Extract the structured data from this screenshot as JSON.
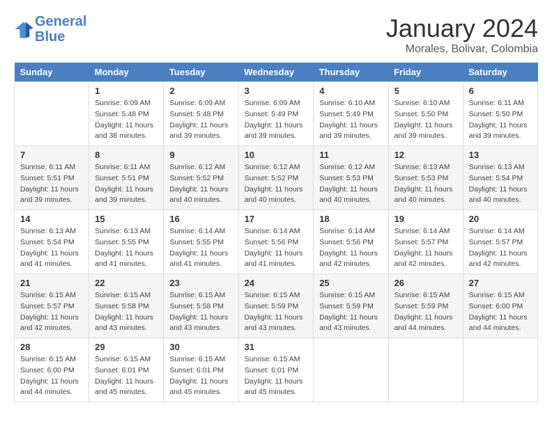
{
  "header": {
    "logo_line1": "General",
    "logo_line2": "Blue",
    "month_year": "January 2024",
    "location": "Morales, Bolivar, Colombia"
  },
  "calendar": {
    "days_of_week": [
      "Sunday",
      "Monday",
      "Tuesday",
      "Wednesday",
      "Thursday",
      "Friday",
      "Saturday"
    ],
    "weeks": [
      [
        {
          "day": "",
          "info": ""
        },
        {
          "day": "1",
          "info": "Sunrise: 6:09 AM\nSunset: 5:48 PM\nDaylight: 11 hours\nand 38 minutes."
        },
        {
          "day": "2",
          "info": "Sunrise: 6:09 AM\nSunset: 5:48 PM\nDaylight: 11 hours\nand 39 minutes."
        },
        {
          "day": "3",
          "info": "Sunrise: 6:09 AM\nSunset: 5:49 PM\nDaylight: 11 hours\nand 39 minutes."
        },
        {
          "day": "4",
          "info": "Sunrise: 6:10 AM\nSunset: 5:49 PM\nDaylight: 11 hours\nand 39 minutes."
        },
        {
          "day": "5",
          "info": "Sunrise: 6:10 AM\nSunset: 5:50 PM\nDaylight: 11 hours\nand 39 minutes."
        },
        {
          "day": "6",
          "info": "Sunrise: 6:11 AM\nSunset: 5:50 PM\nDaylight: 11 hours\nand 39 minutes."
        }
      ],
      [
        {
          "day": "7",
          "info": "Sunrise: 6:11 AM\nSunset: 5:51 PM\nDaylight: 11 hours\nand 39 minutes."
        },
        {
          "day": "8",
          "info": "Sunrise: 6:11 AM\nSunset: 5:51 PM\nDaylight: 11 hours\nand 39 minutes."
        },
        {
          "day": "9",
          "info": "Sunrise: 6:12 AM\nSunset: 5:52 PM\nDaylight: 11 hours\nand 40 minutes."
        },
        {
          "day": "10",
          "info": "Sunrise: 6:12 AM\nSunset: 5:52 PM\nDaylight: 11 hours\nand 40 minutes."
        },
        {
          "day": "11",
          "info": "Sunrise: 6:12 AM\nSunset: 5:53 PM\nDaylight: 11 hours\nand 40 minutes."
        },
        {
          "day": "12",
          "info": "Sunrise: 6:13 AM\nSunset: 5:53 PM\nDaylight: 11 hours\nand 40 minutes."
        },
        {
          "day": "13",
          "info": "Sunrise: 6:13 AM\nSunset: 5:54 PM\nDaylight: 11 hours\nand 40 minutes."
        }
      ],
      [
        {
          "day": "14",
          "info": "Sunrise: 6:13 AM\nSunset: 5:54 PM\nDaylight: 11 hours\nand 41 minutes."
        },
        {
          "day": "15",
          "info": "Sunrise: 6:13 AM\nSunset: 5:55 PM\nDaylight: 11 hours\nand 41 minutes."
        },
        {
          "day": "16",
          "info": "Sunrise: 6:14 AM\nSunset: 5:55 PM\nDaylight: 11 hours\nand 41 minutes."
        },
        {
          "day": "17",
          "info": "Sunrise: 6:14 AM\nSunset: 5:56 PM\nDaylight: 11 hours\nand 41 minutes."
        },
        {
          "day": "18",
          "info": "Sunrise: 6:14 AM\nSunset: 5:56 PM\nDaylight: 11 hours\nand 42 minutes."
        },
        {
          "day": "19",
          "info": "Sunrise: 6:14 AM\nSunset: 5:57 PM\nDaylight: 11 hours\nand 42 minutes."
        },
        {
          "day": "20",
          "info": "Sunrise: 6:14 AM\nSunset: 5:57 PM\nDaylight: 11 hours\nand 42 minutes."
        }
      ],
      [
        {
          "day": "21",
          "info": "Sunrise: 6:15 AM\nSunset: 5:57 PM\nDaylight: 11 hours\nand 42 minutes."
        },
        {
          "day": "22",
          "info": "Sunrise: 6:15 AM\nSunset: 5:58 PM\nDaylight: 11 hours\nand 43 minutes."
        },
        {
          "day": "23",
          "info": "Sunrise: 6:15 AM\nSunset: 5:58 PM\nDaylight: 11 hours\nand 43 minutes."
        },
        {
          "day": "24",
          "info": "Sunrise: 6:15 AM\nSunset: 5:59 PM\nDaylight: 11 hours\nand 43 minutes."
        },
        {
          "day": "25",
          "info": "Sunrise: 6:15 AM\nSunset: 5:59 PM\nDaylight: 11 hours\nand 43 minutes."
        },
        {
          "day": "26",
          "info": "Sunrise: 6:15 AM\nSunset: 5:59 PM\nDaylight: 11 hours\nand 44 minutes."
        },
        {
          "day": "27",
          "info": "Sunrise: 6:15 AM\nSunset: 6:00 PM\nDaylight: 11 hours\nand 44 minutes."
        }
      ],
      [
        {
          "day": "28",
          "info": "Sunrise: 6:15 AM\nSunset: 6:00 PM\nDaylight: 11 hours\nand 44 minutes."
        },
        {
          "day": "29",
          "info": "Sunrise: 6:15 AM\nSunset: 6:01 PM\nDaylight: 11 hours\nand 45 minutes."
        },
        {
          "day": "30",
          "info": "Sunrise: 6:15 AM\nSunset: 6:01 PM\nDaylight: 11 hours\nand 45 minutes."
        },
        {
          "day": "31",
          "info": "Sunrise: 6:15 AM\nSunset: 6:01 PM\nDaylight: 11 hours\nand 45 minutes."
        },
        {
          "day": "",
          "info": ""
        },
        {
          "day": "",
          "info": ""
        },
        {
          "day": "",
          "info": ""
        }
      ]
    ]
  }
}
